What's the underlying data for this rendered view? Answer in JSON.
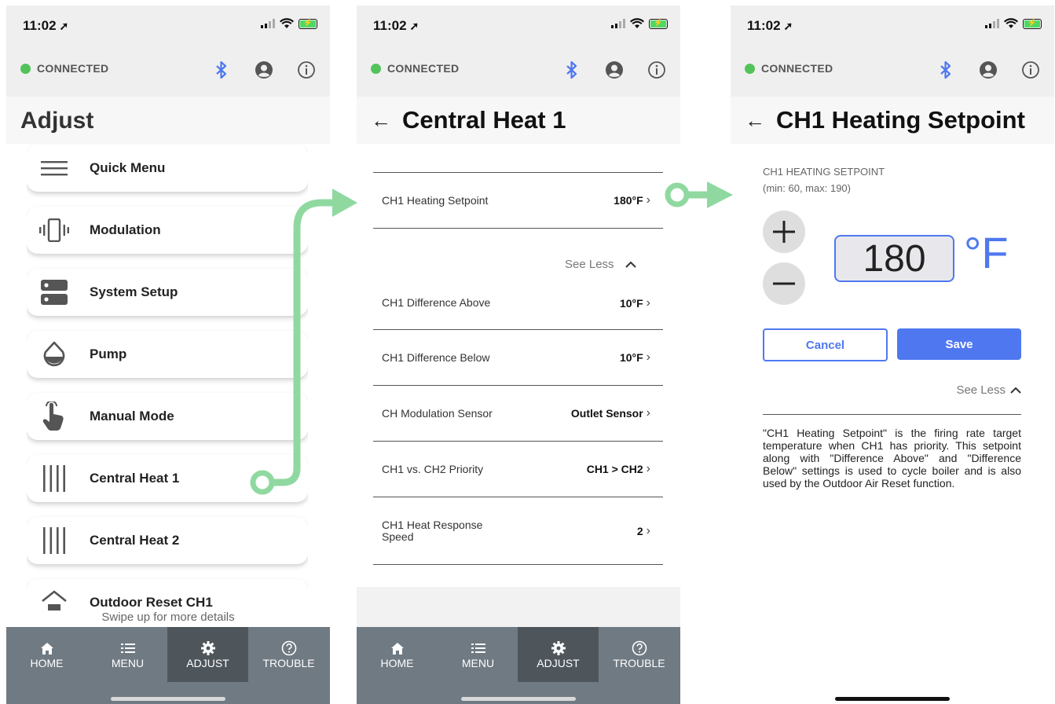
{
  "status_bar": {
    "time": "11:02",
    "location_glyph": "➚"
  },
  "connection": {
    "status": "CONNECTED",
    "color": "#52c35a"
  },
  "colors": {
    "accent": "#4f78f0",
    "tabbar": "#707a82",
    "tab_active": "#4e565c",
    "guide_arrow": "#8fd9a0"
  },
  "screen1": {
    "title": "Adjust",
    "menu_items": [
      {
        "label": "Quick Menu",
        "icon": "hamburger-icon"
      },
      {
        "label": "Modulation",
        "icon": "vibrate-icon"
      },
      {
        "label": "System Setup",
        "icon": "server-icon"
      },
      {
        "label": "Pump",
        "icon": "water-drop-icon"
      },
      {
        "label": "Manual Mode",
        "icon": "hand-pointer-icon"
      },
      {
        "label": "Central Heat 1",
        "icon": "radiator-icon"
      },
      {
        "label": "Central Heat 2",
        "icon": "radiator-icon"
      },
      {
        "label": "Outdoor Reset CH1",
        "icon": "house-temp-icon"
      }
    ],
    "swipe_hint": "Swipe up for more details"
  },
  "tabs": [
    {
      "label": "HOME",
      "icon": "home-icon"
    },
    {
      "label": "MENU",
      "icon": "list-icon"
    },
    {
      "label": "ADJUST",
      "icon": "gear-icon",
      "active": true
    },
    {
      "label": "TROUBLE",
      "icon": "help-circle-icon"
    }
  ],
  "screen2": {
    "title": "Central Heat 1",
    "top_setting": {
      "label": "CH1 Heating Setpoint",
      "value": "180°F"
    },
    "see_less": "See Less",
    "settings": [
      {
        "label": "CH1 Difference Above",
        "value": "10°F"
      },
      {
        "label": "CH1 Difference Below",
        "value": "10°F"
      },
      {
        "label": "CH Modulation Sensor",
        "value": "Outlet Sensor"
      },
      {
        "label": "CH1 vs. CH2 Priority",
        "value": "CH1 > CH2"
      },
      {
        "label": "CH1 Heat Response Speed",
        "value": "2"
      }
    ]
  },
  "screen3": {
    "title": "CH1 Heating Setpoint",
    "setting_label": "CH1 HEATING SETPOINT",
    "range": "(min: 60, max: 190)",
    "value": "180",
    "unit": "°F",
    "cancel_label": "Cancel",
    "save_label": "Save",
    "see_less": "See Less",
    "description": "\"CH1 Heating Setpoint\" is the firing rate target temperature when CH1 has priority. This setpoint along with \"Difference Above\" and \"Difference Below\" settings is used to cycle boiler and is also used by the Outdoor Air Reset function."
  }
}
